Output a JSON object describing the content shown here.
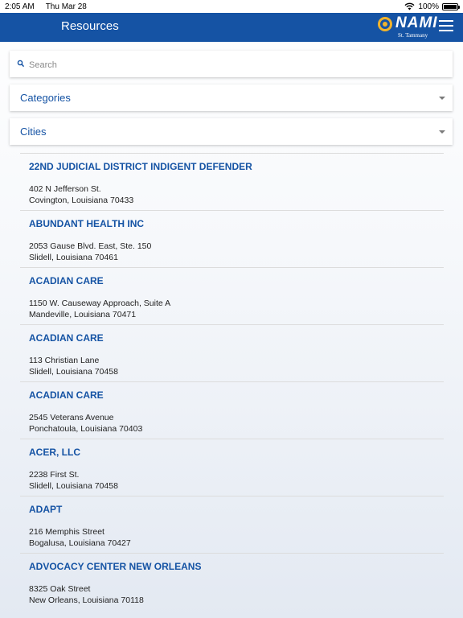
{
  "status_bar": {
    "time": "2:05 AM",
    "date": "Thu Mar 28",
    "battery": "100%",
    "battery_level": 1.0
  },
  "header": {
    "title": "Resources",
    "logo_text": "NAMI",
    "logo_sub": "St. Tammany",
    "menu_icon": "hamburger-menu-icon",
    "background_color": "#1553a4",
    "accent_color": "#f0b32c"
  },
  "search": {
    "placeholder": "Search",
    "value": "",
    "icon": "search-icon"
  },
  "filters": {
    "categories_label": "Categories",
    "cities_label": "Cities"
  },
  "resources": [
    {
      "name": "22ND JUDICIAL DISTRICT INDIGENT DEFENDER",
      "address1": "402 N Jefferson St.",
      "address2": "Covington, Louisiana 70433"
    },
    {
      "name": "ABUNDANT HEALTH INC",
      "address1": "2053 Gause Blvd. East, Ste. 150",
      "address2": "Slidell, Louisiana 70461"
    },
    {
      "name": "ACADIAN CARE",
      "address1": "1150 W. Causeway Approach, Suite A",
      "address2": "Mandeville, Louisiana 70471"
    },
    {
      "name": "ACADIAN CARE",
      "address1": "113 Christian Lane",
      "address2": "Slidell, Louisiana 70458"
    },
    {
      "name": "ACADIAN CARE",
      "address1": "2545 Veterans Avenue",
      "address2": "Ponchatoula, Louisiana 70403"
    },
    {
      "name": "ACER, LLC",
      "address1": "2238 First St.",
      "address2": "Slidell, Louisiana 70458"
    },
    {
      "name": "ADAPT",
      "address1": "216 Memphis Street",
      "address2": "Bogalusa, Louisiana 70427"
    },
    {
      "name": "ADVOCACY CENTER NEW ORLEANS",
      "address1": "8325 Oak Street",
      "address2": "New Orleans, Louisiana 70118"
    }
  ]
}
